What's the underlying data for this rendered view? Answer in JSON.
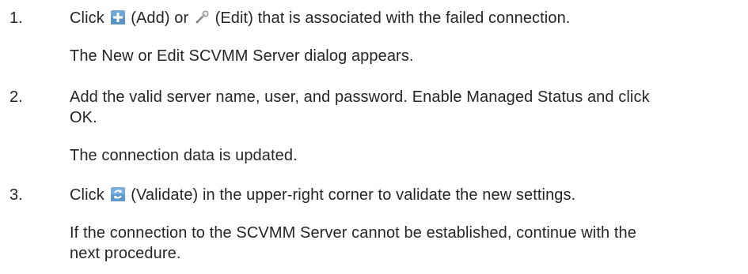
{
  "steps": [
    {
      "number": "1.",
      "click_word": "Click",
      "add_label": "(Add) or",
      "edit_label": "(Edit) that is associated with the failed connection.",
      "result": "The New or Edit SCVMM Server dialog appears."
    },
    {
      "number": "2.",
      "line1": "Add the valid server name, user, and password. Enable Managed Status and click",
      "line2": "OK.",
      "result": "The connection data is updated."
    },
    {
      "number": "3.",
      "click_word": "Click",
      "validate_label": "(Validate) in the upper-right corner to validate the new settings.",
      "result_line1": "If the connection to the SCVMM Server cannot be established, continue with the",
      "result_line2": "next procedure."
    }
  ],
  "icons": {
    "add": "add-plus-icon",
    "edit": "edit-wrench-icon",
    "validate": "validate-arrows-icon"
  },
  "colors": {
    "text": "#262626",
    "add_icon": "#6fa6d6",
    "validate_icon": "#7ab0df"
  }
}
